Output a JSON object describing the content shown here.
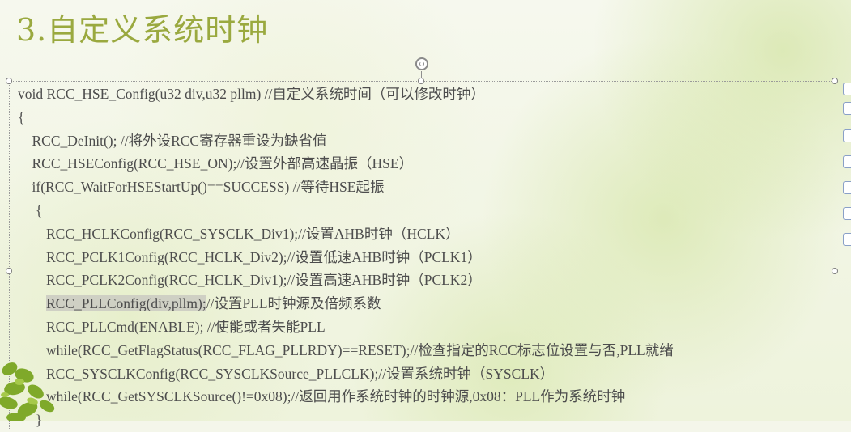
{
  "slide": {
    "title": "3.自定义系统时钟"
  },
  "code_box": {
    "lines": [
      {
        "indent": "",
        "pre": "void RCC_HSE_Config(u32 div,u32 pllm) //自定义系统时间（可以修改时钟）",
        "selected": "",
        "post": ""
      },
      {
        "indent": "",
        "pre": "{",
        "selected": "",
        "post": ""
      },
      {
        "indent": "    ",
        "pre": "RCC_DeInit(); //将外设RCC寄存器重设为缺省值",
        "selected": "",
        "post": ""
      },
      {
        "indent": "    ",
        "pre": "RCC_HSEConfig(RCC_HSE_ON);//设置外部高速晶振（HSE）",
        "selected": "",
        "post": ""
      },
      {
        "indent": "    ",
        "pre": "if(RCC_WaitForHSEStartUp()==SUCCESS) //等待HSE起振",
        "selected": "",
        "post": ""
      },
      {
        "indent": "     ",
        "pre": "{",
        "selected": "",
        "post": ""
      },
      {
        "indent": "        ",
        "pre": "RCC_HCLKConfig(RCC_SYSCLK_Div1);//设置AHB时钟（HCLK）",
        "selected": "",
        "post": ""
      },
      {
        "indent": "        ",
        "pre": "RCC_PCLK1Config(RCC_HCLK_Div2);//设置低速AHB时钟（PCLK1）",
        "selected": "",
        "post": ""
      },
      {
        "indent": "        ",
        "pre": "RCC_PCLK2Config(RCC_HCLK_Div1);//设置高速AHB时钟（PCLK2）",
        "selected": "",
        "post": ""
      },
      {
        "indent": "        ",
        "pre": "",
        "selected": "RCC_PLLConfig(div,pllm);",
        "post": "//设置PLL时钟源及倍频系数"
      },
      {
        "indent": "        ",
        "pre": "RCC_PLLCmd(ENABLE); //使能或者失能PLL",
        "selected": "",
        "post": ""
      },
      {
        "indent": "        ",
        "pre": "while(RCC_GetFlagStatus(RCC_FLAG_PLLRDY)==RESET);//检查指定的RCC标志位设置与否,PLL就绪",
        "selected": "",
        "post": ""
      },
      {
        "indent": "        ",
        "pre": "RCC_SYSCLKConfig(RCC_SYSCLKSource_PLLCLK);//设置系统时钟（SYSCLK）",
        "selected": "",
        "post": ""
      },
      {
        "indent": "        ",
        "pre": "while(RCC_GetSYSCLKSource()!=0x08);//返回用作系统时钟的时钟源,0x08：PLL作为系统时钟",
        "selected": "",
        "post": ""
      },
      {
        "indent": "     ",
        "pre": "}",
        "selected": "",
        "post": ""
      }
    ]
  },
  "colors": {
    "title": "#9aa93f",
    "code_text": "#4d4d4d",
    "selection": "#cfd0c4",
    "handle_border": "#7d7d7d"
  },
  "icons": {
    "rotate_handle": "rotate-handle-icon",
    "plant": "plant-decoration-icon",
    "toolbar_buttons": [
      "layout-options-icon",
      "style-icon",
      "fill-icon",
      "outline-icon",
      "crop-icon",
      "more-icon"
    ]
  }
}
